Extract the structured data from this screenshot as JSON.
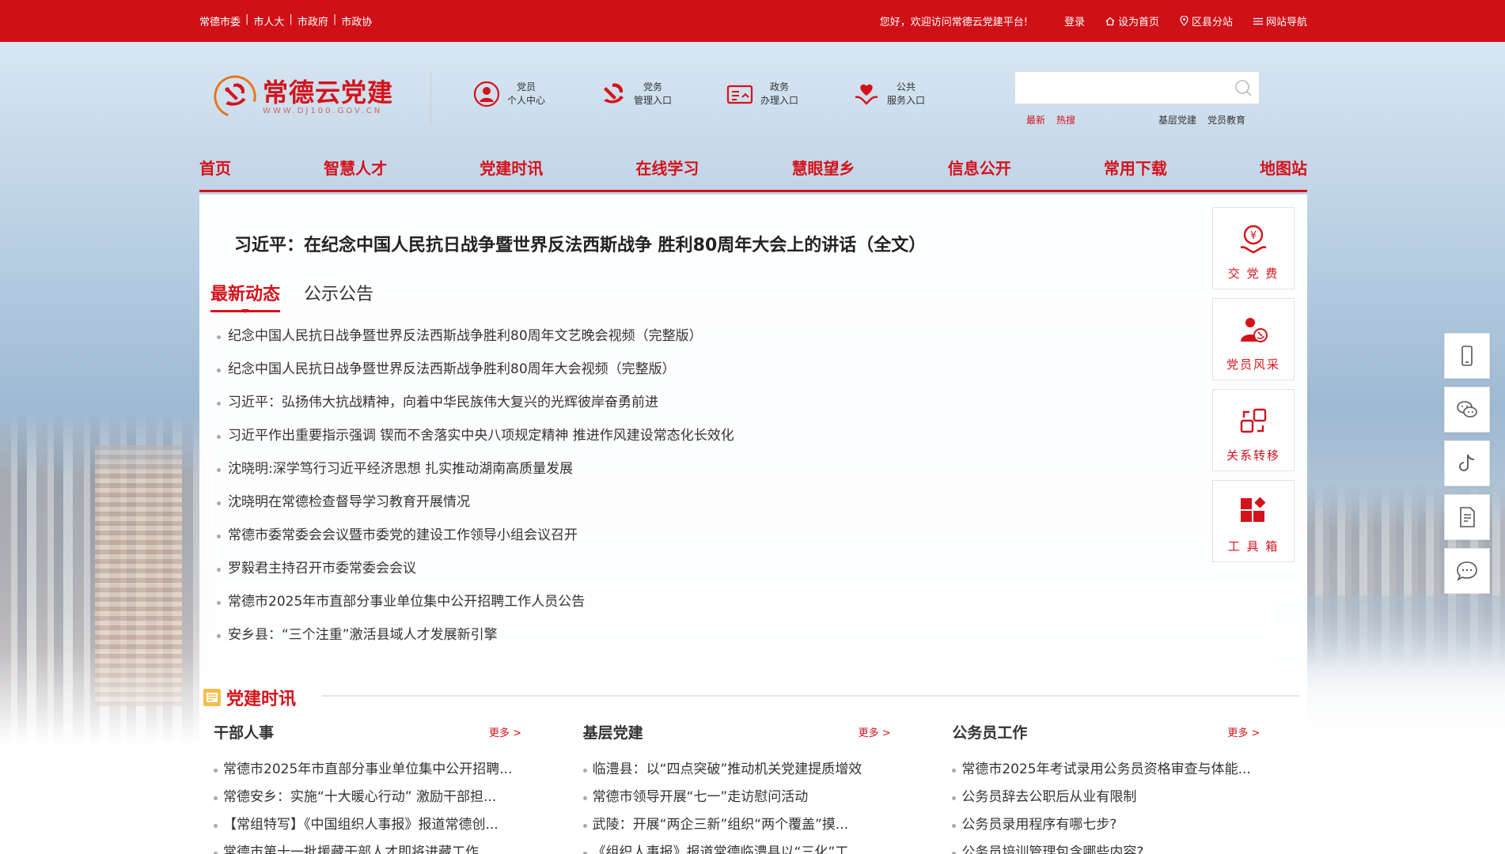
{
  "topbar": {
    "links": [
      "常德市委",
      "市人大",
      "市政府",
      "市政协"
    ],
    "welcome": "您好，欢迎访问常德云党建平台!",
    "login": "登录",
    "set_home": "设为首页",
    "county_site": "区县分站",
    "site_nav": "网站导航"
  },
  "logo": {
    "cn": "常德云党建",
    "en": "WWW.DJ100.GOV.CN"
  },
  "entries": [
    {
      "line1": "党员",
      "line2": "个人中心"
    },
    {
      "line1": "党务",
      "line2": "管理入口"
    },
    {
      "line1": "政务",
      "line2": "办理入口"
    },
    {
      "line1": "公共",
      "line2": "服务入口"
    }
  ],
  "search": {
    "placeholder": "",
    "hot": [
      "最新",
      "热搜"
    ],
    "quick": [
      "基层党建",
      "党员教育"
    ]
  },
  "nav": [
    "首页",
    "智慧人才",
    "党建时讯",
    "在线学习",
    "慧眼望乡",
    "信息公开",
    "常用下载",
    "地图站"
  ],
  "main": {
    "headline": "习近平：在纪念中国人民抗日战争暨世界反法西斯战争 胜利80周年大会上的讲话（全文）",
    "tabs": [
      "最新动态",
      "公示公告"
    ],
    "news": [
      "纪念中国人民抗日战争暨世界反法西斯战争胜利80周年文艺晚会视频（完整版）",
      "纪念中国人民抗日战争暨世界反法西斯战争胜利80周年大会视频（完整版）",
      "习近平：弘扬伟大抗战精神，向着中华民族伟大复兴的光辉彼岸奋勇前进",
      "习近平作出重要指示强调 锲而不舍落实中央八项规定精神 推进作风建设常态化长效化",
      "沈晓明:深学笃行习近平经济思想 扎实推动湖南高质量发展",
      "沈晓明在常德检查督导学习教育开展情况",
      "常德市委常委会会议暨市委党的建设工作领导小组会议召开",
      "罗毅君主持召开市委常委会会议",
      "常德市2025年市直部分事业单位集中公开招聘工作人员公告",
      "安乡县：“三个注重”激活县域人才发展新引擎"
    ]
  },
  "cards": [
    "交 党 费",
    "党员风采",
    "关系转移",
    "工 具 箱"
  ],
  "section": {
    "title": "党建时讯",
    "more": "更多 >",
    "columns": [
      {
        "title": "干部人事",
        "items": [
          "常德市2025年市直部分事业单位集中公开招聘...",
          "常德安乡：实施“十大暖心行动” 激励干部担...",
          "【常组特写】《中国组织人事报》报道常德创...",
          "常德市第十一批援藏干部人才即将进藏工作"
        ]
      },
      {
        "title": "基层党建",
        "items": [
          "临澧县：以“四点突破”推动机关党建提质增效",
          "常德市领导开展“七一”走访慰问活动",
          "武陵：开展“两企三新”组织“两个覆盖”摸...",
          "《组织人事报》报道常德临澧县以“三化”工..."
        ]
      },
      {
        "title": "公务员工作",
        "items": [
          "常德市2025年考试录用公务员资格审查与体能...",
          "公务员辞去公职后从业有限制",
          "公务员录用程序有哪七步?",
          "公务员培训管理包含哪些内容?"
        ]
      }
    ]
  },
  "colors": {
    "brand_red": "#d5121b",
    "topbar_red": "#cf1017"
  }
}
